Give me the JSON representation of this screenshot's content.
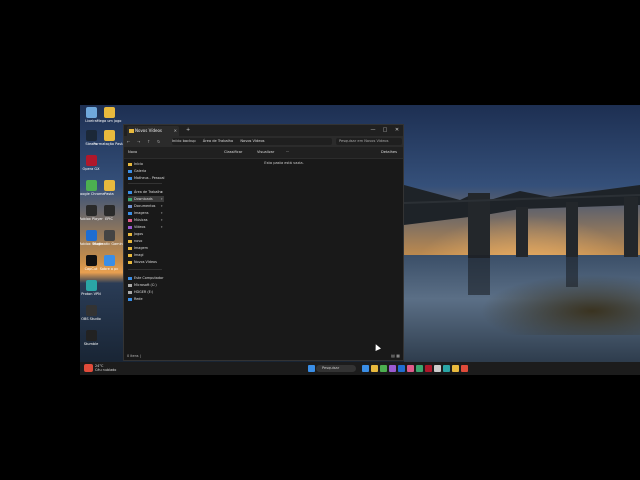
{
  "desktop": {
    "icons": [
      {
        "label": "Lixeira",
        "color": "#6fa8dc"
      },
      {
        "label": "Steam",
        "color": "#1b2838"
      },
      {
        "label": "Opera GX",
        "color": "#b0182b"
      },
      {
        "label": "Google Chrome",
        "color": "#4caf50"
      },
      {
        "label": "Roblox Player",
        "color": "#2a2a2a"
      },
      {
        "label": "Roblox Studio",
        "color": "#1f6dd1"
      },
      {
        "label": "CapCut",
        "color": "#111111"
      },
      {
        "label": "Proton VPN",
        "color": "#2aa6a6"
      },
      {
        "label": "OBS Studio",
        "color": "#333333"
      },
      {
        "label": "Stumble",
        "color": "#222222"
      },
      {
        "label": "Mega um jogo",
        "color": "#e8b93d"
      },
      {
        "label": "Formatação Pasta",
        "color": "#e8b93d"
      },
      {
        "label": "Pasta",
        "color": "#e8b93d"
      },
      {
        "label": "EPIC",
        "color": "#2a2a2a"
      },
      {
        "label": "Magmatic Gaming",
        "color": "#444444"
      },
      {
        "label": "Sobre o pc",
        "color": "#3a8ee6"
      }
    ]
  },
  "explorer": {
    "tab_title": "Novos Vídeos",
    "new_tab": "+",
    "window_controls": [
      "—",
      "□",
      "✕"
    ],
    "nav": [
      "←",
      "→",
      "↑",
      "↻"
    ],
    "breadcrumb": [
      "Início backup",
      "Área de Trabalho",
      "Novos Vídeos"
    ],
    "search_placeholder": "Pesquisar em Novos Vídeos",
    "toolbar": {
      "new": "Novo",
      "sort": "Classificar",
      "view": "Visualizar",
      "more": "···",
      "details": "Detalhes"
    },
    "sidebar": [
      {
        "label": "Início",
        "color": "#e8b93d"
      },
      {
        "label": "Galeria",
        "color": "#3a8ee6"
      },
      {
        "label": "Matheus - Pessoal",
        "color": "#3a8ee6"
      },
      {
        "label": "Área de Trabalho",
        "color": "#3a8ee6",
        "pin": "✦"
      },
      {
        "label": "Downloads",
        "color": "#3aa86f",
        "pin": "✦",
        "selected": true
      },
      {
        "label": "Documentos",
        "color": "#6f8fcf",
        "pin": "✦"
      },
      {
        "label": "Imagens",
        "color": "#3a8ee6",
        "pin": "✦"
      },
      {
        "label": "Músicas",
        "color": "#e05a8a",
        "pin": "✦"
      },
      {
        "label": "Vídeos",
        "color": "#9a5ad1",
        "pin": "✦"
      },
      {
        "label": "Jogos",
        "color": "#e8b93d"
      },
      {
        "label": "novo",
        "color": "#e8b93d"
      },
      {
        "label": "Imagem",
        "color": "#e8b93d"
      },
      {
        "label": "Imagi",
        "color": "#e8b93d"
      },
      {
        "label": "Novos Vídeos",
        "color": "#e8b93d"
      },
      {
        "label": "Este Computador",
        "color": "#3a8ee6"
      },
      {
        "label": "Microsoft (C:)",
        "color": "#aaaaaa"
      },
      {
        "label": "HDGER (E:)",
        "color": "#aaaaaa"
      },
      {
        "label": "Rede",
        "color": "#3a8ee6"
      }
    ],
    "empty_message": "Esta pasta está vazia.",
    "status": "0 itens  |"
  },
  "taskbar": {
    "weather_temp": "24°C",
    "weather_desc": "Céu nublado",
    "search_label": "Pesquisar",
    "apps": [
      "#3a8ee6",
      "#e8b93d",
      "#4caf50",
      "#9a5ad1",
      "#1f6dd1",
      "#e05a8a",
      "#3aa86f",
      "#b0182b",
      "#cccccc",
      "#2aa6a6",
      "#e8b93d",
      "#e04b3a"
    ]
  }
}
